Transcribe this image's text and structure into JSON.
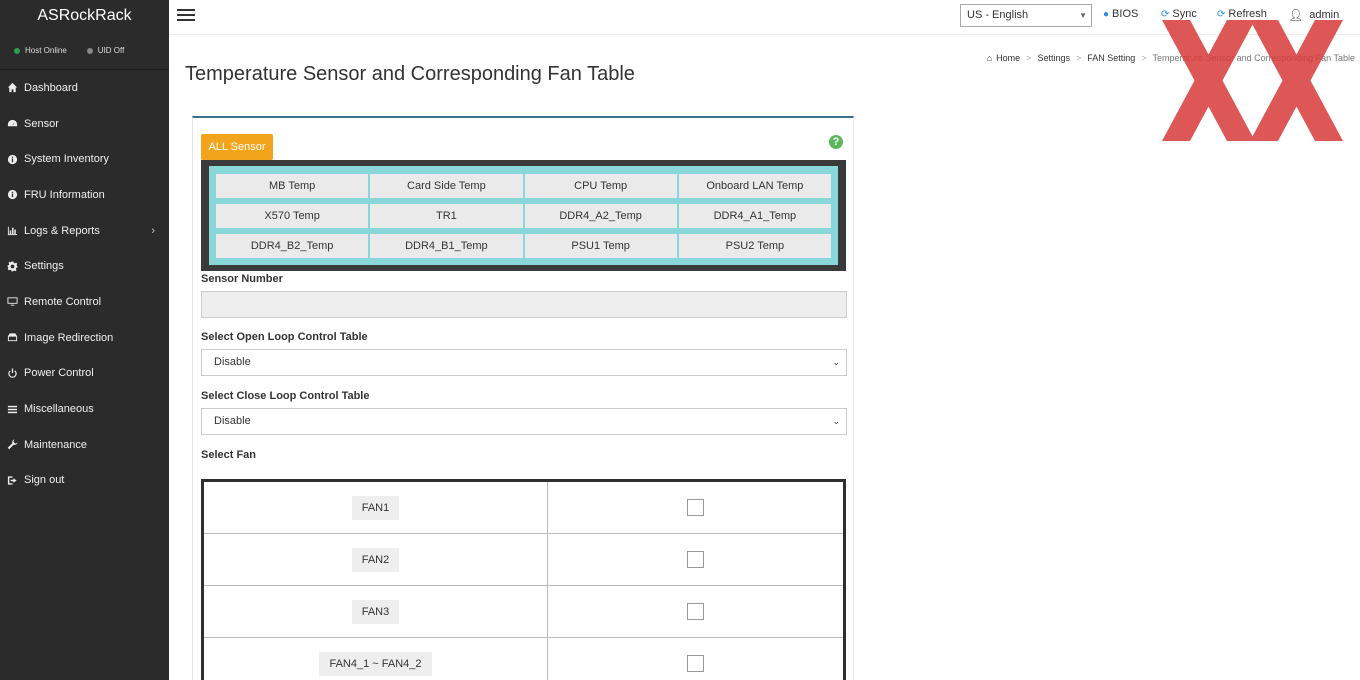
{
  "sidebar": {
    "brand": "ASRockRack",
    "status": {
      "host": "Host Online",
      "uid": "UID Off"
    },
    "items": [
      {
        "label": "Dashboard",
        "icon": "home-icon"
      },
      {
        "label": "Sensor",
        "icon": "dashboard-gauge-icon"
      },
      {
        "label": "System Inventory",
        "icon": "info-icon"
      },
      {
        "label": "FRU Information",
        "icon": "info-icon"
      },
      {
        "label": "Logs & Reports",
        "icon": "bar-chart-icon",
        "chevron": "›"
      },
      {
        "label": "Settings",
        "icon": "gear-icon"
      },
      {
        "label": "Remote Control",
        "icon": "monitor-icon"
      },
      {
        "label": "Image Redirection",
        "icon": "disc-icon"
      },
      {
        "label": "Power Control",
        "icon": "power-icon"
      },
      {
        "label": "Miscellaneous",
        "icon": "list-icon"
      },
      {
        "label": "Maintenance",
        "icon": "wrench-icon"
      },
      {
        "label": "Sign out",
        "icon": "sign-out-icon"
      }
    ]
  },
  "header": {
    "language": "US - English",
    "bios": "BIOS",
    "sync": "Sync",
    "refresh": "Refresh",
    "user": "admin"
  },
  "breadcrumb": [
    "Home",
    "Settings",
    "FAN Setting",
    "Temperature Sensor and Corresponding Fan Table"
  ],
  "page": {
    "title": "Temperature Sensor and Corresponding Fan Table",
    "tab": "ALL Sensor",
    "sensors": [
      "MB Temp",
      "Card Side Temp",
      "CPU Temp",
      "Onboard LAN Temp",
      "X570 Temp",
      "TR1",
      "DDR4_A2_Temp",
      "DDR4_A1_Temp",
      "DDR4_B2_Temp",
      "DDR4_B1_Temp",
      "PSU1 Temp",
      "PSU2 Temp"
    ],
    "sensor_number_label": "Sensor Number",
    "sensor_number_value": "",
    "open_loop_label": "Select Open Loop Control Table",
    "open_loop_value": "Disable",
    "close_loop_label": "Select Close Loop Control Table",
    "close_loop_value": "Disable",
    "select_fan_label": "Select Fan",
    "fans": [
      "FAN1",
      "FAN2",
      "FAN3",
      "FAN4_1 ~ FAN4_2"
    ]
  },
  "colors": {
    "sidebar_bg": "#2b2b2b",
    "accent_orange": "#f2a51c",
    "sensor_panel": "#8ad7d9",
    "panel_border": "#3d6f8e",
    "status_green": "#2e9e4f"
  }
}
